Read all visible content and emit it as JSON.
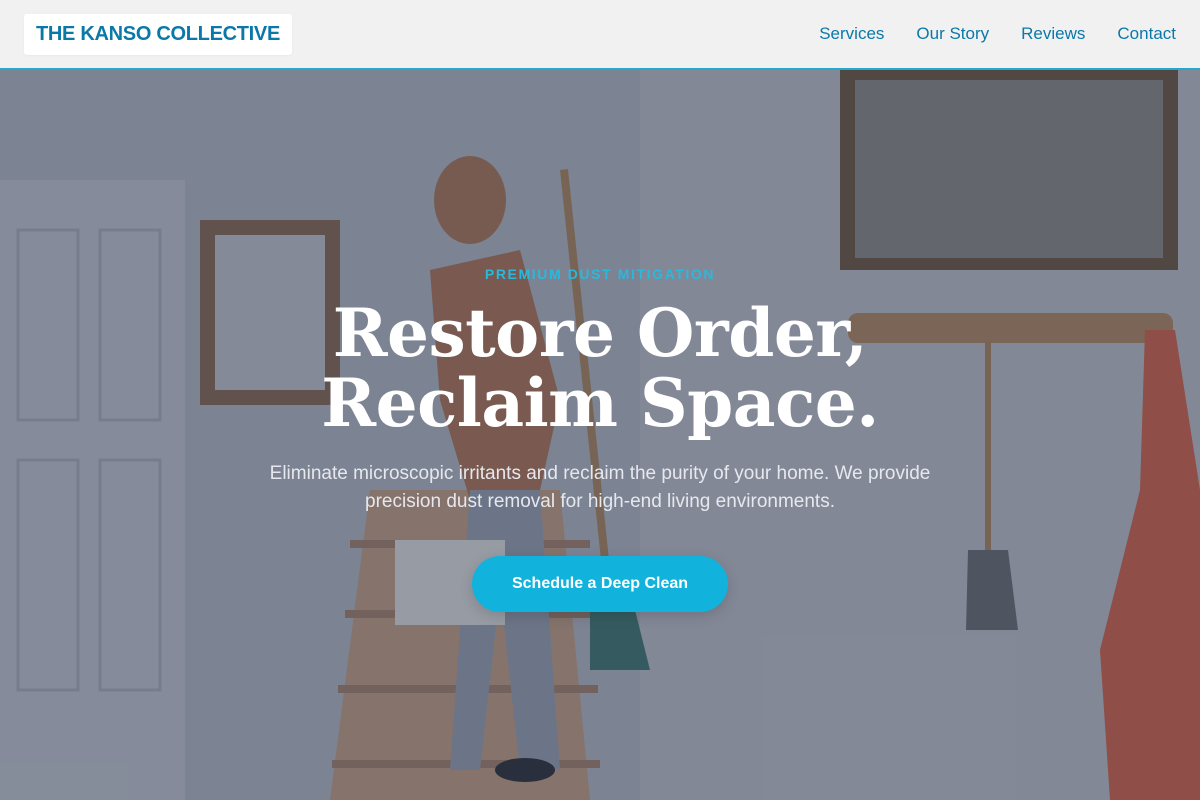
{
  "brand": {
    "name": "THE KANSO COLLECTIVE"
  },
  "nav": {
    "items": [
      {
        "label": "Services"
      },
      {
        "label": "Our Story"
      },
      {
        "label": "Reviews"
      },
      {
        "label": "Contact"
      }
    ]
  },
  "hero": {
    "eyebrow": "PREMIUM DUST MITIGATION",
    "headline_line1": "Restore Order,",
    "headline_line2": "Reclaim Space.",
    "subtext": "Eliminate microscopic irritants and reclaim the purity of your home. We provide precision dust removal for high-end living environments.",
    "cta_label": "Schedule a Deep Clean",
    "background_image": "photo-woman-carrying-cleaning-supplies-up-stairs"
  },
  "colors": {
    "accent": "#11b3dc",
    "brand_text": "#0b78a8",
    "header_bg": "#f1f1f2",
    "overlay": "rgba(40,48,66,0.42)"
  }
}
